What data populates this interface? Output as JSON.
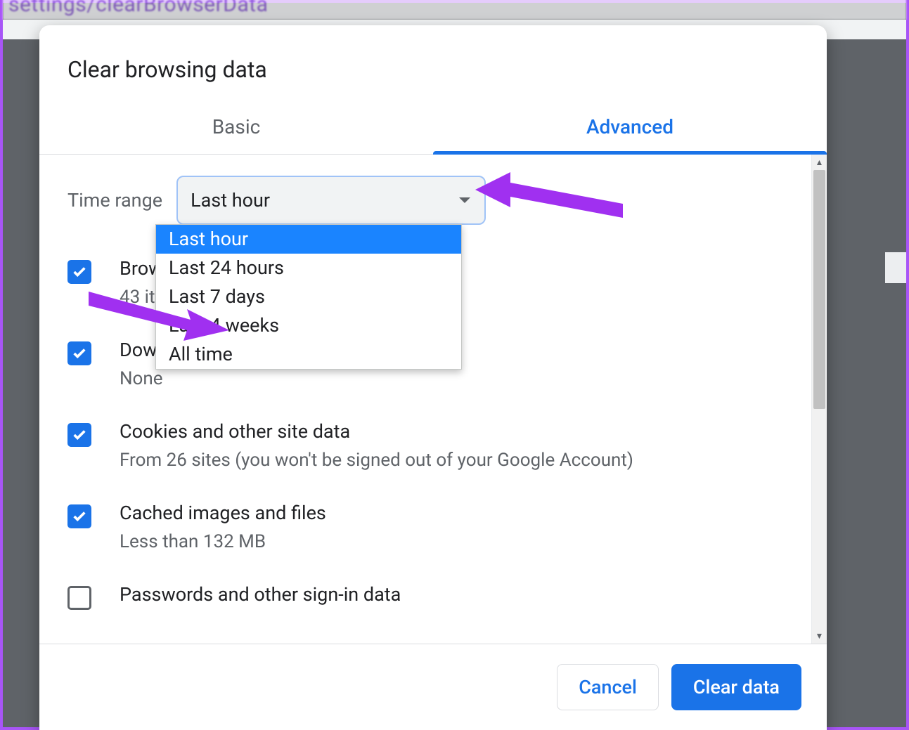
{
  "url_fragment": "settings/clearBrowserData",
  "dialog": {
    "title": "Clear browsing data",
    "tabs": {
      "basic": "Basic",
      "advanced": "Advanced",
      "active": "advanced"
    },
    "time_range": {
      "label": "Time range",
      "selected": "Last hour",
      "options": [
        "Last hour",
        "Last 24 hours",
        "Last 7 days",
        "Last 4 weeks",
        "All time"
      ]
    },
    "items": [
      {
        "title": "Browsing history",
        "sub": "43 items",
        "checked": true
      },
      {
        "title": "Download history",
        "sub": "None",
        "checked": true
      },
      {
        "title": "Cookies and other site data",
        "sub": "From 26 sites (you won't be signed out of your Google Account)",
        "checked": true
      },
      {
        "title": "Cached images and files",
        "sub": "Less than 132 MB",
        "checked": true
      },
      {
        "title": "Passwords and other sign-in data",
        "sub": "",
        "checked": false
      }
    ],
    "footer": {
      "cancel": "Cancel",
      "confirm": "Clear data"
    }
  }
}
